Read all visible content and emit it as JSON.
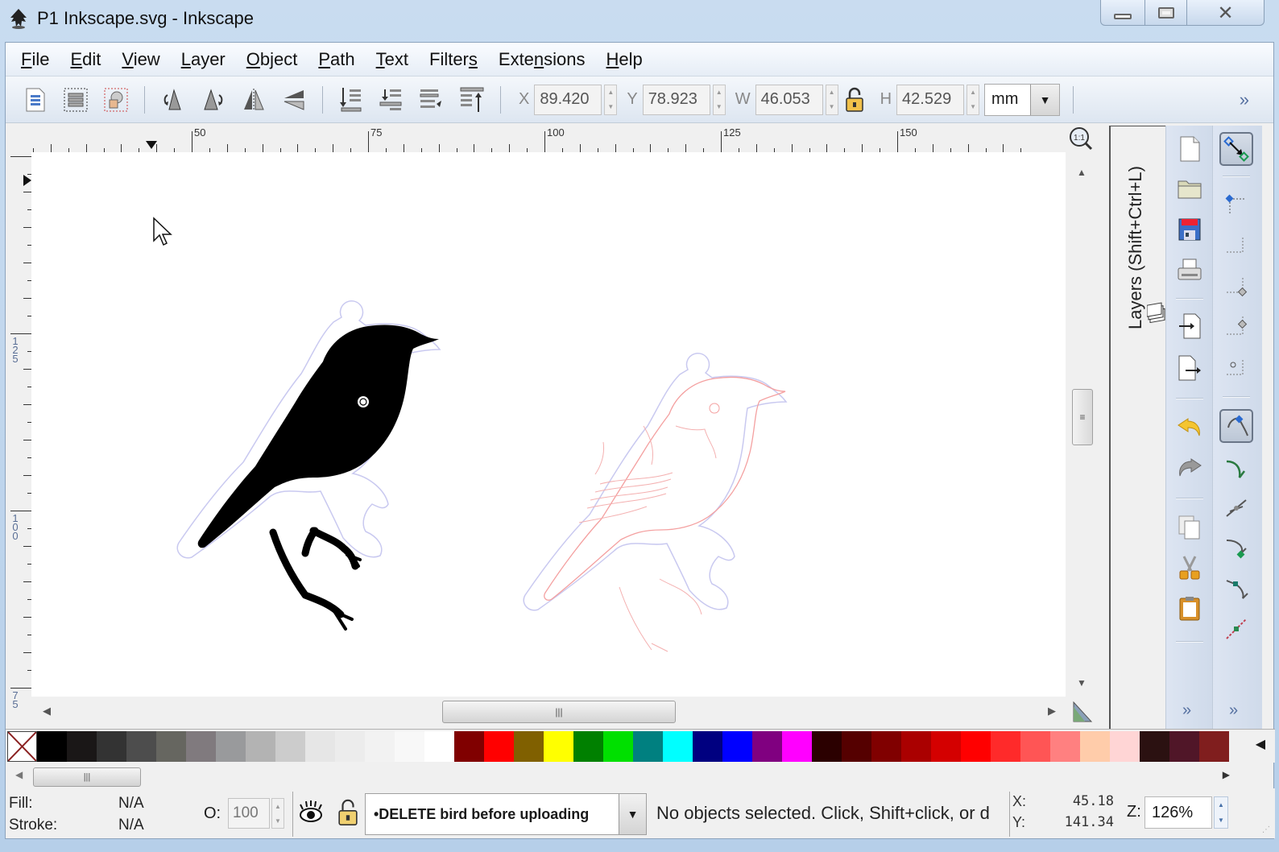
{
  "window": {
    "title": "P1 Inkscape.svg - Inkscape",
    "controls": {
      "minimize": "minimize",
      "maximize": "maximize",
      "close": "close"
    }
  },
  "menu": [
    {
      "label": "File",
      "accel": "F"
    },
    {
      "label": "Edit",
      "accel": "E"
    },
    {
      "label": "View",
      "accel": "V"
    },
    {
      "label": "Layer",
      "accel": "L"
    },
    {
      "label": "Object",
      "accel": "O"
    },
    {
      "label": "Path",
      "accel": "P"
    },
    {
      "label": "Text",
      "accel": "T"
    },
    {
      "label": "Filters",
      "accel": "s"
    },
    {
      "label": "Extensions",
      "accel": "n"
    },
    {
      "label": "Help",
      "accel": "H"
    }
  ],
  "toolbar": {
    "icons": [
      "select-all-icon",
      "select-all-layers-icon",
      "deselect-icon",
      "rotate-ccw-icon",
      "rotate-cw-icon",
      "flip-horizontal-icon",
      "flip-vertical-icon",
      "lower-to-bottom-icon",
      "lower-icon",
      "raise-icon",
      "raise-to-top-icon"
    ],
    "x_label": "X",
    "x_value": "89.420",
    "y_label": "Y",
    "y_value": "78.923",
    "w_label": "W",
    "w_value": "46.053",
    "h_label": "H",
    "h_value": "42.529",
    "unit": "mm",
    "more": "»"
  },
  "rulers": {
    "horizontal": [
      "50",
      "75",
      "100",
      "125",
      "150"
    ],
    "vertical": [
      "125",
      "100",
      "75"
    ]
  },
  "canvas": {
    "objects": [
      {
        "name": "black-bird-silhouette",
        "fill": "#000000"
      },
      {
        "name": "outline-bird-engraving",
        "stroke": "#f4a6a6"
      }
    ],
    "cut_outline_color": "#c8c8f0"
  },
  "dock": {
    "layers_tab": "Layers (Shift+Ctrl+L)"
  },
  "commands_bar": [
    "new-document-icon",
    "open-icon",
    "save-icon",
    "print-icon",
    "import-icon",
    "export-icon",
    "undo-icon",
    "redo-icon",
    "duplicate-icon",
    "cut-icon",
    "paste-icon"
  ],
  "snap_bar": [
    "snap-toggle-icon",
    "snap-bbox-icon",
    "snap-bbox-edges-icon",
    "snap-bbox-corners-icon",
    "snap-bbox-midpoints-icon",
    "snap-bbox-center-icon",
    "snap-nodes-icon",
    "snap-paths-icon",
    "snap-intersections-icon",
    "snap-cusp-nodes-icon",
    "snap-smooth-nodes-icon",
    "snap-midpoints-icon"
  ],
  "palette": {
    "colors": [
      "#000000",
      "#1a1717",
      "#333333",
      "#4d4d4d",
      "#666660",
      "#807a7e",
      "#999a9c",
      "#b3b3b3",
      "#cccccc",
      "#e6e6e6",
      "#ececec",
      "#f2f2f2",
      "#f8f8f8",
      "#ffffff",
      "#800000",
      "#ff0000",
      "#806000",
      "#ffff00",
      "#008000",
      "#00e000",
      "#008080",
      "#00ffff",
      "#000080",
      "#0000ff",
      "#800080",
      "#ff00ff",
      "#2b0000",
      "#550000",
      "#800000",
      "#aa0000",
      "#d40000",
      "#ff0000",
      "#ff2a2a",
      "#ff5555",
      "#ff8080",
      "#ffccaa",
      "#ffd5d5",
      "#2b1111",
      "#501628",
      "#801e1e"
    ]
  },
  "status": {
    "fill_label": "Fill:",
    "fill_value": "N/A",
    "stroke_label": "Stroke:",
    "stroke_value": "N/A",
    "opacity_label": "O:",
    "opacity_value": "100",
    "current_layer": "•DELETE bird before uploading",
    "message": "No objects selected. Click, Shift+click, or d",
    "cursor_x_label": "X:",
    "cursor_x": "45.18",
    "cursor_y_label": "Y:",
    "cursor_y": "141.34",
    "zoom_label": "Z:",
    "zoom_value": "126%"
  }
}
